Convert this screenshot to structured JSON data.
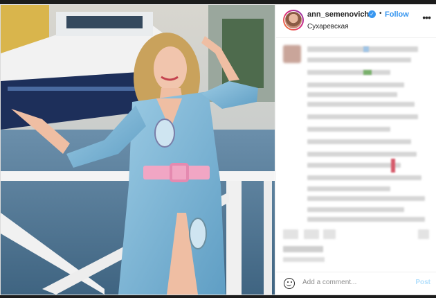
{
  "post": {
    "username": "ann_semenovich",
    "separator": "•",
    "follow_label": "Follow",
    "location": "Сухаревская",
    "more_icon": "more-options-icon"
  },
  "comment_box": {
    "placeholder": "Add a comment...",
    "post_label": "Post"
  },
  "colors": {
    "accent": "#3897f0",
    "post_disabled": "#b2dffc",
    "dress": "#7fb6d6",
    "belt": "#f1a6c4"
  }
}
